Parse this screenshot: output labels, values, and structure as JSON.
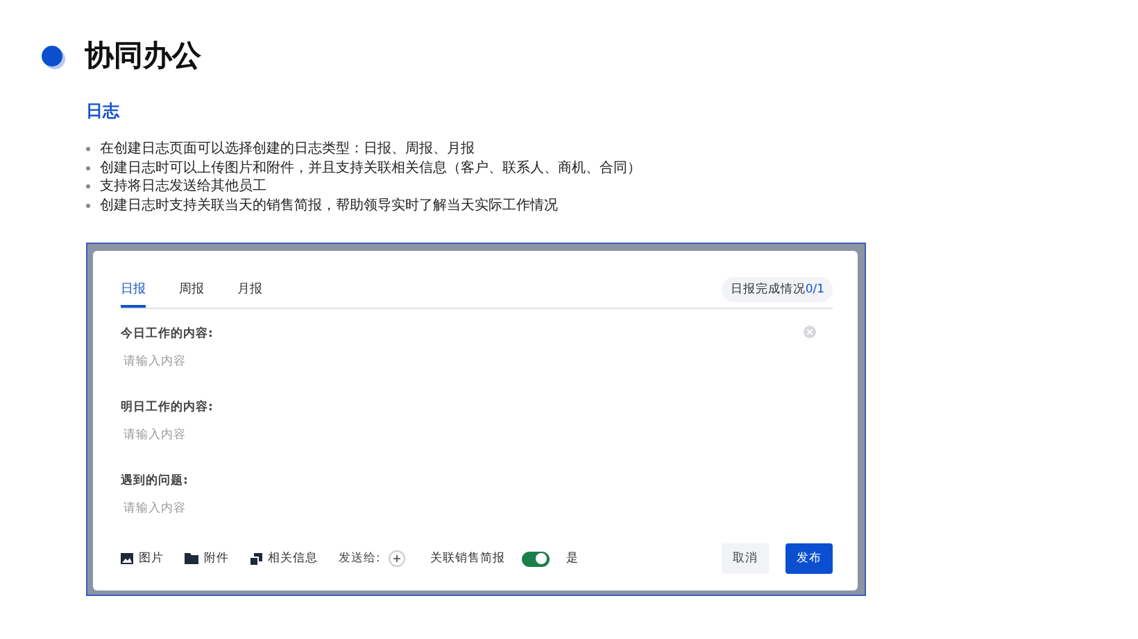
{
  "title": "协同办公",
  "section": "日志",
  "bullets": [
    "在创建日志页面可以选择创建的日志类型：日报、周报、月报",
    "创建日志时可以上传图片和附件，并且支持关联相关信息（客户、联系人、商机、合同）",
    "支持将日志发送给其他员工",
    "创建日志时支持关联当天的销售简报，帮助领导实时了解当天实际工作情况"
  ],
  "dialog": {
    "tabs": [
      {
        "label": "日报",
        "selected": true
      },
      {
        "label": "周报",
        "selected": false
      },
      {
        "label": "月报",
        "selected": false
      }
    ],
    "completion": {
      "label": "日报完成情况",
      "count": "0/1"
    },
    "fields": [
      {
        "label": "今日工作的内容:",
        "placeholder": "请输入内容"
      },
      {
        "label": "明日工作的内容:",
        "placeholder": "请输入内容"
      },
      {
        "label": "遇到的问题:",
        "placeholder": "请输入内容"
      }
    ],
    "toolbar": [
      {
        "kind": "image",
        "label": "图片"
      },
      {
        "kind": "folder",
        "label": "附件"
      },
      {
        "kind": "link",
        "label": "相关信息"
      }
    ],
    "send_to": "发送给:",
    "switch": {
      "label": "关联销售简报",
      "on": true,
      "value": "是"
    },
    "buttons": [
      {
        "label": "取消",
        "kind": "secondary"
      },
      {
        "label": "发布",
        "kind": "primary"
      }
    ]
  }
}
